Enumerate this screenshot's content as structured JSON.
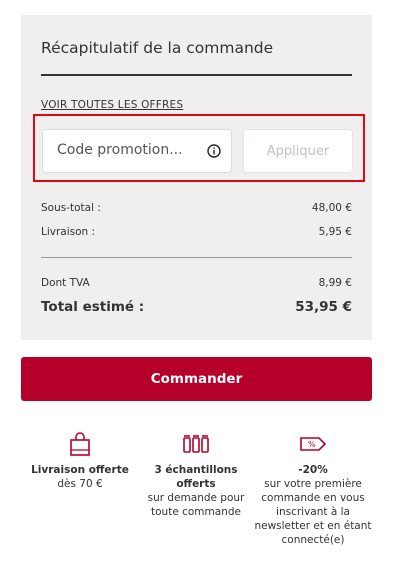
{
  "summary": {
    "title": "Récapitulatif de la commande",
    "offers_link": "VOIR TOUTES LES OFFRES",
    "promo": {
      "placeholder": "Code promotion...",
      "apply_label": "Appliquer"
    },
    "rows": [
      {
        "label": "Sous-total :",
        "value": "48,00 €"
      },
      {
        "label": "Livraison :",
        "value": "5,95 €"
      }
    ],
    "tax": {
      "label": "Dont TVA",
      "value": "8,99 €"
    },
    "total": {
      "label": "Total estimé :",
      "value": "53,95 €"
    }
  },
  "order_button": "Commander",
  "benefits": [
    {
      "icon": "shopping-bag-icon",
      "title": "Livraison offerte",
      "desc": "dès 70 €"
    },
    {
      "icon": "sample-bottles-icon",
      "title": "3 échantillons offerts",
      "desc": "sur demande pour toute commande"
    },
    {
      "icon": "discount-tag-icon",
      "title": "-20%",
      "desc": "sur votre première commande en vous inscrivant à la newsletter et en étant connecté(e)"
    }
  ],
  "colors": {
    "accent": "#b5002a",
    "highlight": "#e30613",
    "panel": "#f1efed"
  }
}
